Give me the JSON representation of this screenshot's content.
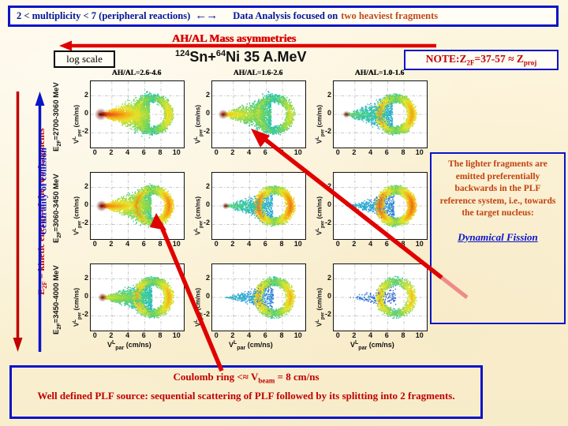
{
  "top_banner": {
    "multiplicity_text": "2 < multiplicity < 7 (peripheral reactions)",
    "arrows": "←→",
    "analysis_text": "Data Analysis focused on",
    "highlight_text": "two heaviest fragments"
  },
  "mass_asymmetry_title": "AH/AL Mass asymmetries",
  "log_scale_label": "log scale",
  "reaction_title": {
    "sup1": "124",
    "el1": "Sn+",
    "sup2": "64",
    "el2": "Ni 35 A.MeV"
  },
  "note_box": {
    "label": "NOTE:Z",
    "sub1": "2F",
    "range": "=37-57 ≈ Z",
    "sub2": "proj"
  },
  "left_axis": {
    "energy_label": "E",
    "energy_sub": "2F",
    "energy_rest": " = kinetic energy of the two fragments",
    "centrality_label": "Centrality of collision"
  },
  "plots": {
    "column_headers": [
      "AH/AL=2.6-4.6",
      "AH/AL=1.6-2.6",
      "AH/AL=1.0-1.6"
    ],
    "row_labels": [
      {
        "pre": "E",
        "sub": "2F",
        "post": "=2700-3060 MeV"
      },
      {
        "pre": "E",
        "sub": "2F",
        "post": "=3060-3450 MeV"
      },
      {
        "pre": "E",
        "sub": "2F",
        "post": "=3450-4000 MeV"
      }
    ],
    "x_label": {
      "v": "V",
      "sup": "L",
      "sub": "par",
      "unit": " (cm/ns)"
    },
    "y_label": {
      "v": "V",
      "sup": "L",
      "sub": "per",
      "unit": " (cm/ns)"
    },
    "x_ticks": [
      "0",
      "2",
      "4",
      "6",
      "8",
      "10"
    ],
    "y_ticks": [
      "2",
      "0",
      "-2"
    ]
  },
  "explain_box": {
    "paragraph": "The lighter fragments are emitted preferentially backwards in the PLF reference system, i.e., towards the target nucleus:",
    "conclusion": "Dynamical Fission"
  },
  "bottom_banner": {
    "line1_a": "Coulomb ring <≈ V",
    "line1_sub": "beam",
    "line1_b": " = 8 cm/ns",
    "line2": "Well defined PLF source: sequential scattering of PLF followed by its splitting into 2 fragments."
  },
  "colors": {
    "banner_blue": "#0a14c8",
    "red": "#c00000",
    "orange": "#c2420f",
    "background": "#fdf5dd",
    "arrow_red": "#e00000"
  },
  "chart_data": {
    "type": "heatmap",
    "title": "124Sn+64Ni 35 A.MeV — V_par vs V_per density maps (log scale)",
    "xlabel": "V^L_par (cm/ns)",
    "ylabel": "V^L_per (cm/ns)",
    "xlim": [
      -0.6,
      10.8
    ],
    "ylim": [
      -3.6,
      3.6
    ],
    "grid": true,
    "columns": [
      "AH/AL=2.6-4.6",
      "AH/AL=1.6-2.6",
      "AH/AL=1.0-1.6"
    ],
    "rows": [
      "E2F=2700-3060 MeV",
      "E2F=3060-3450 MeV",
      "E2F=3450-4000 MeV"
    ],
    "colorscale": [
      "#2b3fd0",
      "#2aa6d8",
      "#35c9a0",
      "#8ad84a",
      "#e8e32a",
      "#f5a413",
      "#e8531a",
      "#8f0d06"
    ],
    "beam_velocity": 8,
    "coulomb_ring_center": 7.0,
    "coulomb_ring_radius": 1.9,
    "panels": [
      {
        "row": 0,
        "col": 0,
        "wedge_intensity": 1.0,
        "ring_intensity": 0.62,
        "counts": 9500,
        "wedge_apex": 0.4,
        "wedge_tip": 6.6,
        "wedge_halfwidth": 3.1
      },
      {
        "row": 0,
        "col": 1,
        "wedge_intensity": 0.72,
        "ring_intensity": 0.55,
        "counts": 6200,
        "wedge_apex": 0.5,
        "wedge_tip": 6.6,
        "wedge_halfwidth": 3.0
      },
      {
        "row": 0,
        "col": 2,
        "wedge_intensity": 0.42,
        "ring_intensity": 0.72,
        "counts": 4200,
        "wedge_apex": 0.7,
        "wedge_tip": 6.6,
        "wedge_halfwidth": 2.8
      },
      {
        "row": 1,
        "col": 0,
        "wedge_intensity": 0.88,
        "ring_intensity": 0.78,
        "counts": 7600,
        "wedge_apex": 0.5,
        "wedge_tip": 6.8,
        "wedge_halfwidth": 2.9
      },
      {
        "row": 1,
        "col": 1,
        "wedge_intensity": 0.4,
        "ring_intensity": 0.8,
        "counts": 4300,
        "wedge_apex": 0.8,
        "wedge_tip": 6.8,
        "wedge_halfwidth": 2.5
      },
      {
        "row": 1,
        "col": 2,
        "wedge_intensity": 0.22,
        "ring_intensity": 0.82,
        "counts": 3100,
        "wedge_apex": 1.0,
        "wedge_tip": 6.8,
        "wedge_halfwidth": 2.2
      },
      {
        "row": 2,
        "col": 0,
        "wedge_intensity": 0.6,
        "ring_intensity": 0.7,
        "counts": 4800,
        "wedge_apex": 0.6,
        "wedge_tip": 6.9,
        "wedge_halfwidth": 2.6
      },
      {
        "row": 2,
        "col": 1,
        "wedge_intensity": 0.22,
        "ring_intensity": 0.68,
        "counts": 2600,
        "wedge_apex": 1.0,
        "wedge_tip": 6.9,
        "wedge_halfwidth": 2.2
      },
      {
        "row": 2,
        "col": 2,
        "wedge_intensity": 0.1,
        "ring_intensity": 0.66,
        "counts": 1700,
        "wedge_apex": 1.4,
        "wedge_tip": 7.0,
        "wedge_halfwidth": 1.8
      }
    ]
  }
}
